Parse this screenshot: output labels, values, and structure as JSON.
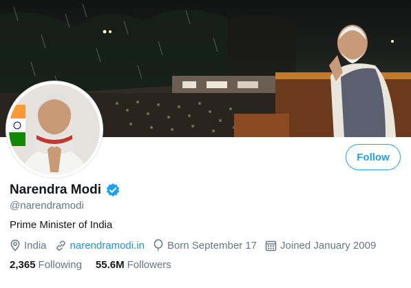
{
  "profile": {
    "display_name": "Narendra Modi",
    "handle": "@narendramodi",
    "bio": "Prime Minister of India",
    "location": "India",
    "website": "narendramodi.in",
    "birthday": "Born September 17",
    "joined": "Joined January 2009"
  },
  "stats": {
    "following_count": "2,365",
    "following_label": "Following",
    "followers_count": "55.6M",
    "followers_label": "Followers"
  },
  "actions": {
    "follow_label": "Follow"
  },
  "icons": {
    "verified": "verified-badge-icon",
    "location": "location-pin-icon",
    "link": "link-icon",
    "birthday": "balloon-icon",
    "calendar": "calendar-icon"
  },
  "colors": {
    "accent": "#1da1f2",
    "link": "#1b95e0",
    "secondary_text": "#657786",
    "primary_text": "#14171a"
  }
}
